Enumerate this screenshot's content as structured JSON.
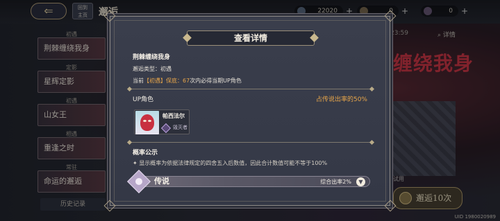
{
  "background": {
    "title": "邂逅",
    "home_label_1": "回到",
    "home_label_2": "主页",
    "resources": [
      {
        "icon": "currency-icon",
        "value": "22020"
      },
      {
        "icon": "ticket-icon",
        "value": "0"
      },
      {
        "icon": "ticket-alt-icon",
        "value": "0"
      }
    ],
    "sidebar": [
      {
        "category": "初遇",
        "label": "荆棘缠绕我身"
      },
      {
        "category": "定影",
        "label": "星辉定影"
      },
      {
        "category": "初遇",
        "label": "山女王"
      },
      {
        "category": "相遇",
        "label": "重逢之时"
      },
      {
        "category": "常驻",
        "label": "命运的邂逅"
      }
    ],
    "history_label": "历史记录",
    "big_title": "缠绕我身",
    "time_text": "23:59",
    "detail_label": "详情",
    "use_text": "试用",
    "pull10_label": "邂逅10次",
    "uid": "UID 1980020989"
  },
  "dialog": {
    "title": "查看详情",
    "pool_name": "荆棘缠绕我身",
    "pool_type": "邂逅类型：初遇",
    "guarantee_prefix": "当前",
    "guarantee_highlight": "【初遇】保底：",
    "guarantee_count": "67",
    "guarantee_suffix": "次内必得当期UP角色",
    "up_section": {
      "header": "UP角色",
      "rate": "占传说出率的50%",
      "characters": [
        {
          "name": "帕西法尔",
          "class": "毁灭者"
        }
      ]
    },
    "probability": {
      "title": "概率公示",
      "note": "✦ 显示概率为依据法律规定的四舍五入后数值，因此合计数值可能不等于100%",
      "tiers": [
        {
          "label": "传说",
          "rate": "综合出率2%"
        }
      ]
    }
  }
}
